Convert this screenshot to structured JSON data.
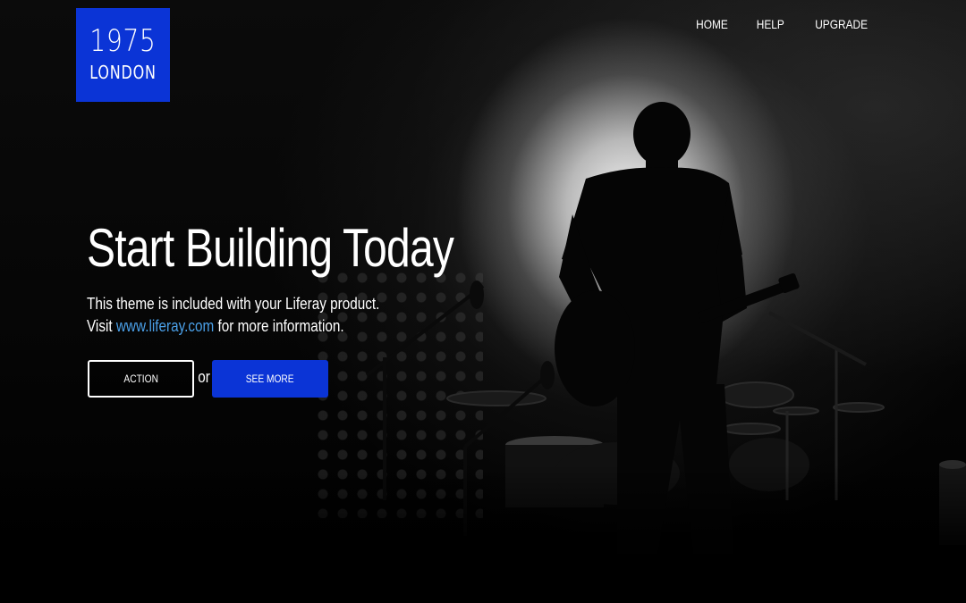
{
  "logo": {
    "year": "1975",
    "city": "LONDON",
    "color": "#0b34d6"
  },
  "nav": {
    "items": [
      "HOME",
      "HELP",
      "UPGRADE"
    ]
  },
  "hero": {
    "title": "Start Building Today",
    "line1": "This theme is included with your Liferay product.",
    "line2_prefix": "Visit ",
    "link_text": "www.liferay.com",
    "line2_suffix": " for more information.",
    "link_color": "#4ba0e8"
  },
  "buttons": {
    "action_label": "ACTION",
    "or_text": "or",
    "see_more_label": "SEE MORE",
    "see_more_color": "#0b34d6"
  },
  "background": {
    "scene": "concert-guitarist-silhouette-photo"
  }
}
